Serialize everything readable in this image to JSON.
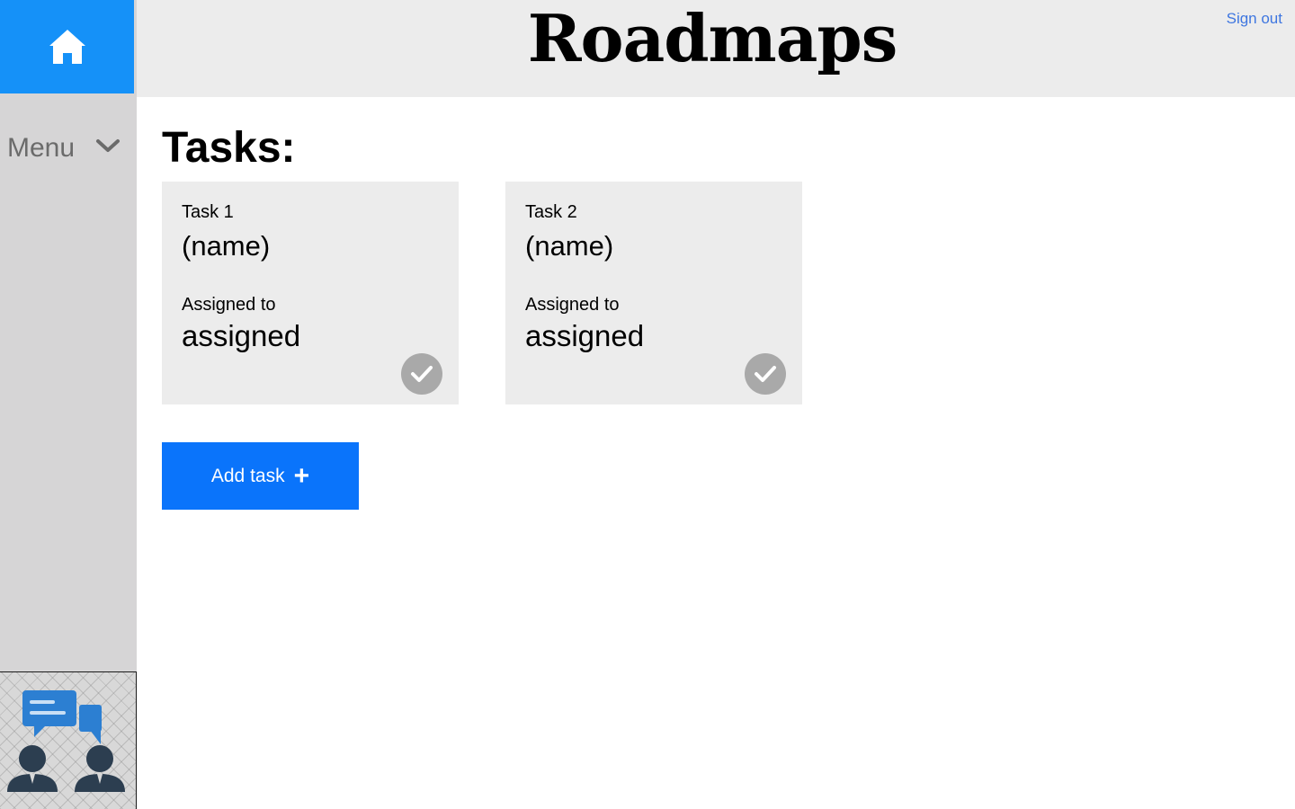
{
  "header": {
    "title": "Roadmaps",
    "sign_out_label": "Sign out"
  },
  "sidebar": {
    "home_icon": "home-icon",
    "menu_label": "Menu",
    "menu_icon": "chevron-down-icon",
    "support_icon": "team-chat-icon"
  },
  "main": {
    "heading": "Tasks:",
    "tasks": [
      {
        "number": "Task 1",
        "name": "(name)",
        "assigned_label": "Assigned to",
        "assigned_value": "assigned",
        "status_icon": "checkmark-icon"
      },
      {
        "number": "Task 2",
        "name": "(name)",
        "assigned_label": "Assigned to",
        "assigned_value": "assigned",
        "status_icon": "checkmark-icon"
      }
    ],
    "add_task_label": "Add task",
    "add_task_icon": "+"
  },
  "colors": {
    "home_tile": "#1591f8",
    "header_bg": "#ececec",
    "sidebar_bg": "#d6d5d6",
    "card_bg": "#ececec",
    "primary_button": "#0a74fb",
    "link": "#3e76e0",
    "check_circle": "#a9a9a9"
  }
}
